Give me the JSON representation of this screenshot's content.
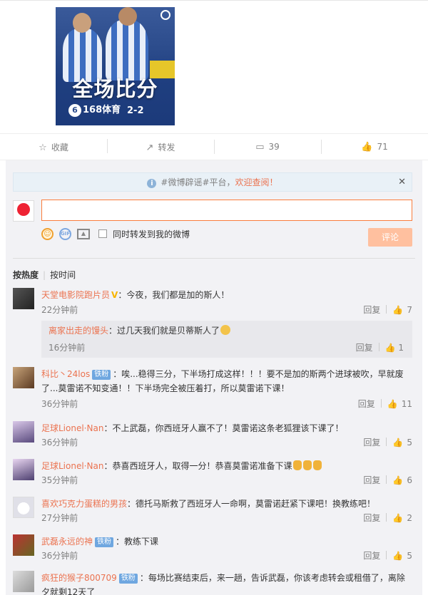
{
  "media": {
    "headline": "全场比分",
    "brand": "168体育",
    "brand_logo": "6",
    "score": "2-2"
  },
  "actions": {
    "favorite": "收藏",
    "repost": "转发",
    "comment_count": "39",
    "like_count": "71"
  },
  "notice": {
    "text": "#微博辟谣#平台，",
    "welcome": "欢迎查阅！"
  },
  "composer": {
    "repost_label": "同时转发到我的微博",
    "submit_label": "评论"
  },
  "sort": {
    "hot": "按热度",
    "time": "按时间"
  },
  "comments": [
    {
      "name": "天堂电影院跑片员",
      "verified": "V",
      "text": "：今夜，我们都是加的斯人！",
      "time": "22分钟前",
      "reply": "回复",
      "likes": "7",
      "sub": {
        "name": "离家出走的馒头",
        "text": "：过几天我们就是贝蒂斯人了",
        "time": "16分钟前",
        "reply": "回复",
        "likes": "1"
      }
    },
    {
      "name": "科比丶24los",
      "badge": "铁粉",
      "text": "：唉...稳得三分，下半场打成这样！！！要不是加的斯两个进球被吹，早就废了...莫雷诺不知变通！！下半场完全被压着打，所以莫雷诺下课！",
      "time": "36分钟前",
      "reply": "回复",
      "likes": "11"
    },
    {
      "name": "足球Lionel·Nan",
      "text": "：不上武磊，你西班牙人赢不了！莫雷诺这条老狐狸该下课了！",
      "time": "36分钟前",
      "reply": "回复",
      "likes": "5"
    },
    {
      "name": "足球Lionel·Nan",
      "text": "：恭喜西班牙人，取得一分！恭喜莫雷诺准备下课",
      "time": "35分钟前",
      "reply": "回复",
      "likes": "6"
    },
    {
      "name": "喜欢巧克力蛋糕的男孩",
      "text": "：德托马斯救了西班牙人一命啊，莫雷诺赶紧下课吧！换教练吧！",
      "time": "27分钟前",
      "reply": "回复",
      "likes": "2"
    },
    {
      "name": "武磊永远的神",
      "badge": "铁粉",
      "text": "：教练下课",
      "time": "36分钟前",
      "reply": "回复",
      "likes": "5"
    },
    {
      "name": "疯狂的猴子800709",
      "badge": "铁粉",
      "text": "：每场比赛结束后，来一趟，告诉武磊，你该考虑转会或租借了，离除夕就剩12天了"
    }
  ]
}
